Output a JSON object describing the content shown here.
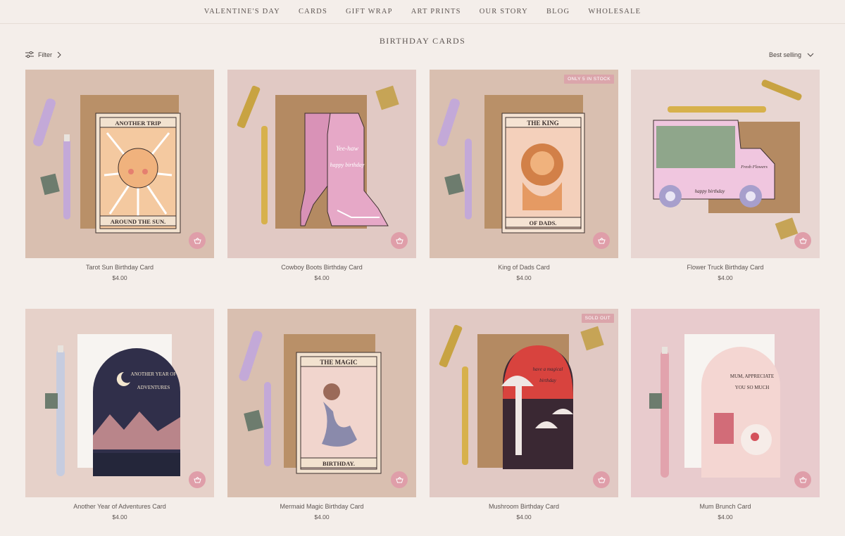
{
  "nav": {
    "items": [
      "VALENTINE'S DAY",
      "CARDS",
      "GIFT WRAP",
      "ART PRINTS",
      "OUR STORY",
      "BLOG",
      "WHOLESALE"
    ]
  },
  "page": {
    "title": "BIRTHDAY CARDS",
    "filter_label": "Filter",
    "sort_label": "Best selling"
  },
  "products": [
    {
      "name": "Tarot Sun Birthday Card",
      "price": "$4.00",
      "badge": "",
      "art_line1": "ANOTHER TRIP",
      "art_line2": "AROUND THE SUN."
    },
    {
      "name": "Cowboy Boots Birthday Card",
      "price": "$4.00",
      "badge": "",
      "art_line1": "Yee-haw",
      "art_line2": "happy birthday"
    },
    {
      "name": "King of Dads Card",
      "price": "$4.00",
      "badge": "ONLY 5 IN STOCK",
      "art_line1": "THE KING",
      "art_line2": "OF DADS."
    },
    {
      "name": "Flower Truck Birthday Card",
      "price": "$4.00",
      "badge": "",
      "art_line1": "Fresh Flowers",
      "art_line2": "happy birthday"
    },
    {
      "name": "Another Year of Adventures Card",
      "price": "$4.00",
      "badge": "",
      "art_line1": "ANOTHER YEAR OF",
      "art_line2": "ADVENTURES"
    },
    {
      "name": "Mermaid Magic Birthday Card",
      "price": "$4.00",
      "badge": "",
      "art_line1": "THE MAGIC",
      "art_line2": "BIRTHDAY."
    },
    {
      "name": "Mushroom Birthday Card",
      "price": "$4.00",
      "badge": "SOLD OUT",
      "art_line1": "have a magical",
      "art_line2": "birthday"
    },
    {
      "name": "Mum Brunch Card",
      "price": "$4.00",
      "badge": "",
      "art_line1": "MUM, APPRECIATE",
      "art_line2": "YOU SO MUCH"
    }
  ],
  "icons": {
    "filter": "sliders-icon",
    "filter_chevron": "chevron-right-icon",
    "sort_chevron": "chevron-down-icon",
    "cart": "basket-icon"
  },
  "colors": {
    "background": "#f4eeea",
    "badge": "#dba5ab",
    "cart_button": "#df9ea9"
  }
}
